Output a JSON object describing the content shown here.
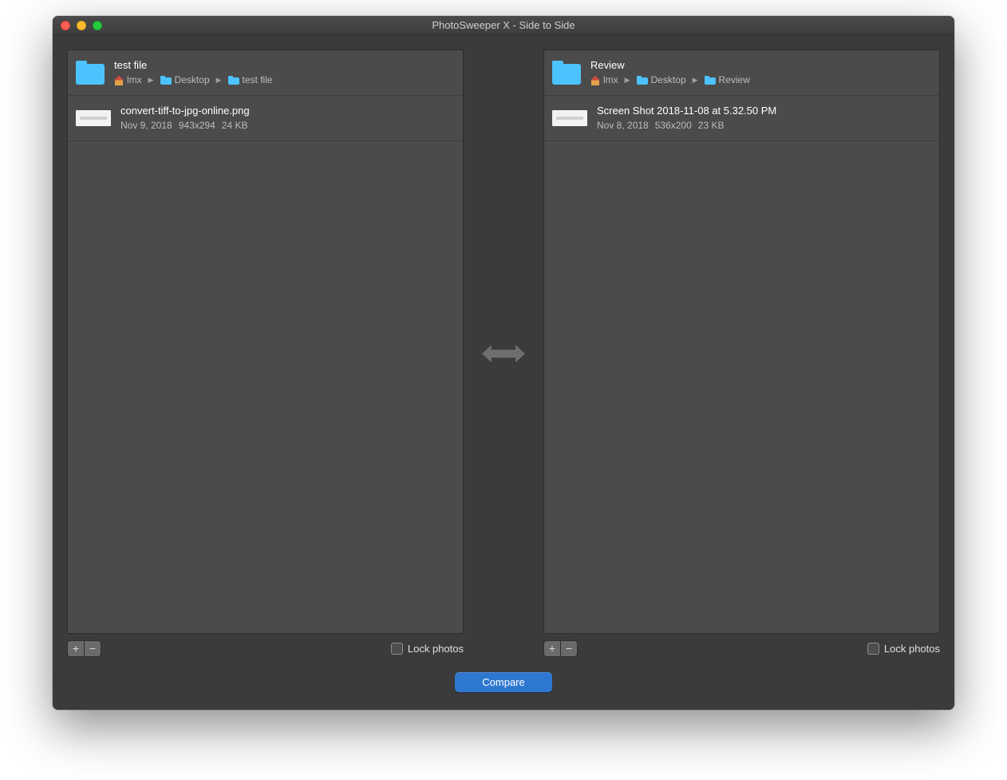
{
  "window": {
    "title": "PhotoSweeper X - Side to Side"
  },
  "left": {
    "folder": {
      "name": "test file",
      "path": [
        "lmx",
        "Desktop",
        "test file"
      ]
    },
    "item": {
      "name": "convert-tiff-to-jpg-online.png",
      "date": "Nov 9, 2018",
      "dimensions": "943x294",
      "size": "24 KB"
    },
    "lock_label": "Lock photos"
  },
  "right": {
    "folder": {
      "name": "Review",
      "path": [
        "lmx",
        "Desktop",
        "Review"
      ]
    },
    "item": {
      "name": "Screen Shot 2018-11-08 at 5.32.50 PM",
      "date": "Nov 8, 2018",
      "dimensions": "536x200",
      "size": "23 KB"
    },
    "lock_label": "Lock photos"
  },
  "buttons": {
    "add": "+",
    "remove": "−",
    "compare": "Compare"
  }
}
